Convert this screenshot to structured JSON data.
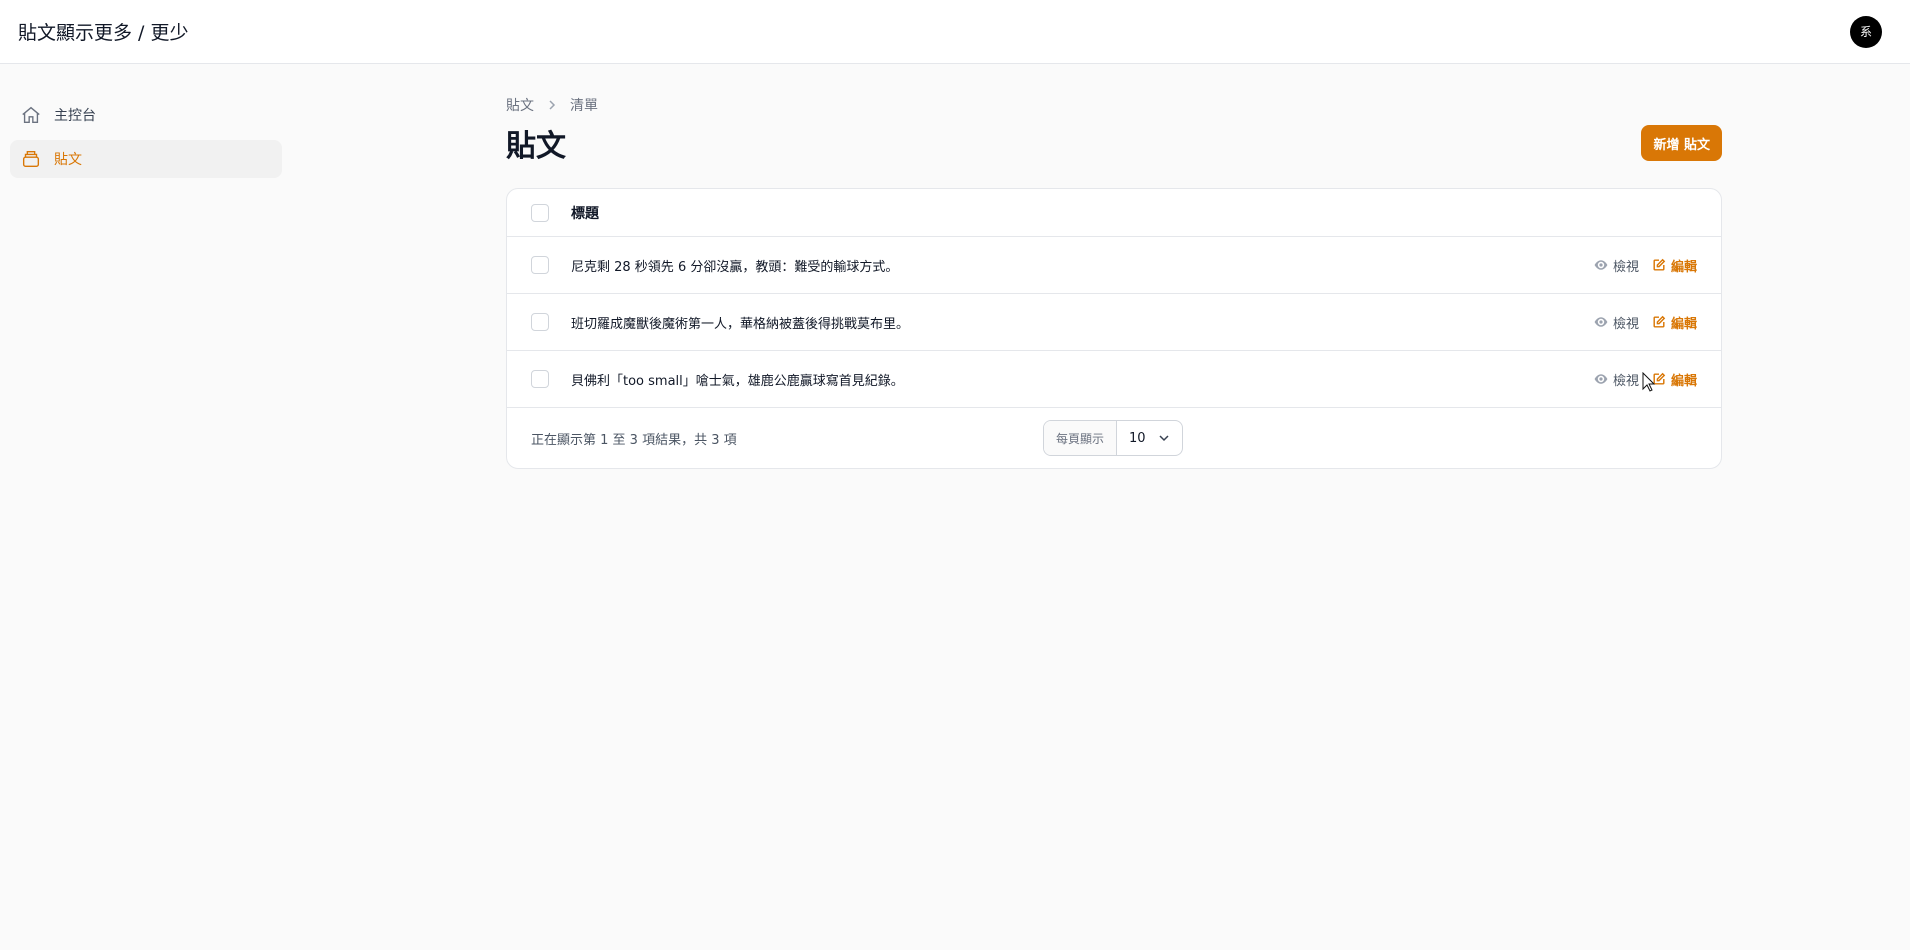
{
  "app": {
    "title": "貼文顯示更多 / 更少",
    "avatar_initial": "系"
  },
  "sidebar": {
    "items": [
      {
        "label": "主控台",
        "icon": "home-icon",
        "active": false
      },
      {
        "label": "貼文",
        "icon": "archive-icon",
        "active": true
      }
    ]
  },
  "breadcrumb": {
    "items": [
      "貼文",
      "清單"
    ]
  },
  "page": {
    "title": "貼文",
    "new_button": "新增 貼文"
  },
  "table": {
    "column_title": "標題",
    "rows": [
      {
        "title": "尼克剩 28 秒領先 6 分卻沒贏，教頭：難受的輸球方式。"
      },
      {
        "title": "班切羅成魔獸後魔術第一人，華格納被蓋後得挑戰莫布里。"
      },
      {
        "title": "貝佛利「too small」嗆士氣，雄鹿公鹿贏球寫首見紀錄。"
      }
    ],
    "action_view": "檢視",
    "action_edit": "編輯",
    "summary": "正在顯示第 1 至 3 項結果，共 3 項",
    "per_page_label": "每頁顯示",
    "per_page_value": "10"
  },
  "colors": {
    "accent": "#d97706",
    "background": "#fafafa"
  }
}
